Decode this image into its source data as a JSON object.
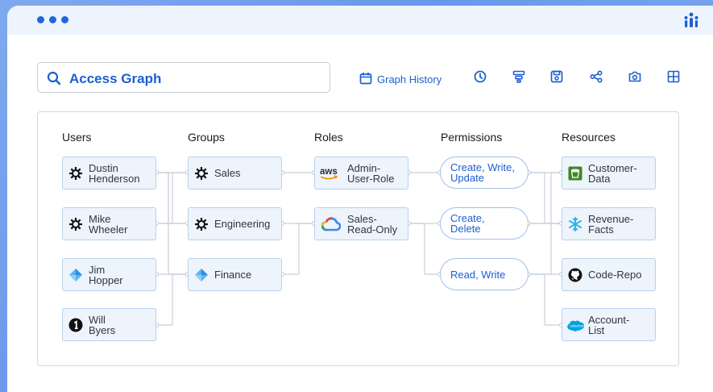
{
  "search": {
    "label": "Access Graph"
  },
  "toolbar": {
    "graph_history_label": "Graph History",
    "icons": [
      "calendar-icon",
      "clock-icon",
      "filter-icon",
      "save-icon",
      "share-icon",
      "camera-icon",
      "grid-icon"
    ]
  },
  "columns": {
    "users": "Users",
    "groups": "Groups",
    "roles": "Roles",
    "permissions": "Permissions",
    "resources": "Resources"
  },
  "users": [
    {
      "line1": "Dustin",
      "line2": "Henderson",
      "icon": "okta-icon"
    },
    {
      "line1": "Mike",
      "line2": "Wheeler",
      "icon": "okta-icon"
    },
    {
      "line1": "Jim",
      "line2": "Hopper",
      "icon": "azure-icon"
    },
    {
      "line1": "Will",
      "line2": "Byers",
      "icon": "onelogin-icon"
    }
  ],
  "groups": [
    {
      "label": "Sales",
      "icon": "okta-icon"
    },
    {
      "label": "Engineering",
      "icon": "okta-icon"
    },
    {
      "label": "Finance",
      "icon": "azure-icon"
    }
  ],
  "roles": [
    {
      "line1": "Admin-",
      "line2": "User-Role",
      "icon": "aws-icon"
    },
    {
      "line1": "Sales-",
      "line2": "Read-Only",
      "icon": "google-cloud-icon"
    }
  ],
  "permissions": [
    {
      "line1": "Create, Write,",
      "line2": "Update"
    },
    {
      "line1": "Create,",
      "line2": "Delete"
    },
    {
      "line1": "Read, Write",
      "line2": ""
    }
  ],
  "resources": [
    {
      "line1": "Customer-",
      "line2": "Data",
      "icon": "bucket-icon"
    },
    {
      "line1": "Revenue-",
      "line2": "Facts",
      "icon": "snowflake-icon"
    },
    {
      "line1": "Code-Repo",
      "line2": "",
      "icon": "github-icon"
    },
    {
      "line1": "Account-",
      "line2": "List",
      "icon": "salesforce-icon"
    }
  ],
  "colors": {
    "accent": "#1d5fd0",
    "node_bg": "#eef4fc",
    "node_border": "#b7d0ee",
    "line": "#c9cfd8"
  }
}
